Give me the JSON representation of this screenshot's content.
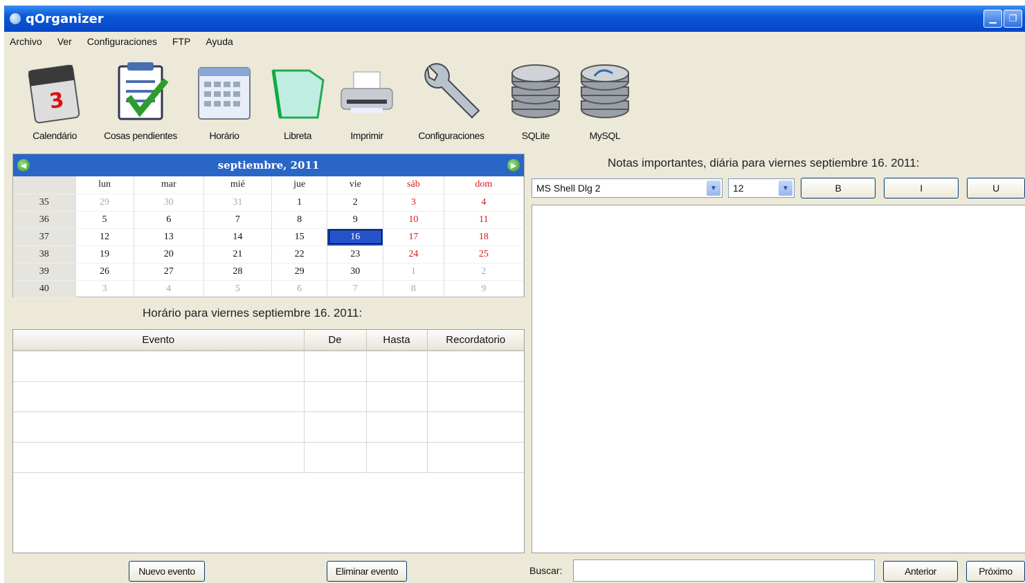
{
  "window": {
    "title": "qOrganizer"
  },
  "menu": [
    "Archivo",
    "Ver",
    "Configuraciones",
    "FTP",
    "Ayuda"
  ],
  "toolbar": {
    "items": [
      "Calendário",
      "Cosas pendientes",
      "Horário",
      "Libreta",
      "Imprimir",
      "Configuraciones",
      "SQLite",
      "MySQL"
    ]
  },
  "calendar": {
    "month_label": "septiembre,  2011",
    "weekdays": [
      "lun",
      "mar",
      "mié",
      "jue",
      "vie",
      "sáb",
      "dom"
    ],
    "weeks": [
      {
        "num": "35",
        "days": [
          "29",
          "30",
          "31",
          "1",
          "2",
          "3",
          "4"
        ]
      },
      {
        "num": "36",
        "days": [
          "5",
          "6",
          "7",
          "8",
          "9",
          "10",
          "11"
        ]
      },
      {
        "num": "37",
        "days": [
          "12",
          "13",
          "14",
          "15",
          "16",
          "17",
          "18"
        ]
      },
      {
        "num": "38",
        "days": [
          "19",
          "20",
          "21",
          "22",
          "23",
          "24",
          "25"
        ]
      },
      {
        "num": "39",
        "days": [
          "26",
          "27",
          "28",
          "29",
          "30",
          "1",
          "2"
        ]
      },
      {
        "num": "40",
        "days": [
          "3",
          "4",
          "5",
          "6",
          "7",
          "8",
          "9"
        ]
      }
    ],
    "selected": "16"
  },
  "schedule": {
    "caption": "Horário para viernes septiembre 16. 2011:",
    "columns": [
      "Evento",
      "De",
      "Hasta",
      "Recordatorio"
    ],
    "row_count": 4,
    "add_button": "Nuevo evento",
    "delete_button": "Eliminar evento"
  },
  "notes": {
    "caption": "Notas importantes, diária para viernes septiembre 16. 2011:",
    "font_name": "MS Shell Dlg 2",
    "font_size": "12",
    "bold": "B",
    "italic": "I",
    "underline": "U",
    "search_label": "Buscar:",
    "prev_button": "Anterior",
    "next_button": "Próximo"
  },
  "colors": {
    "title_blue": "#0a58d8",
    "weekend_red": "#d21a1a",
    "selected_blue": "#2452c8"
  }
}
